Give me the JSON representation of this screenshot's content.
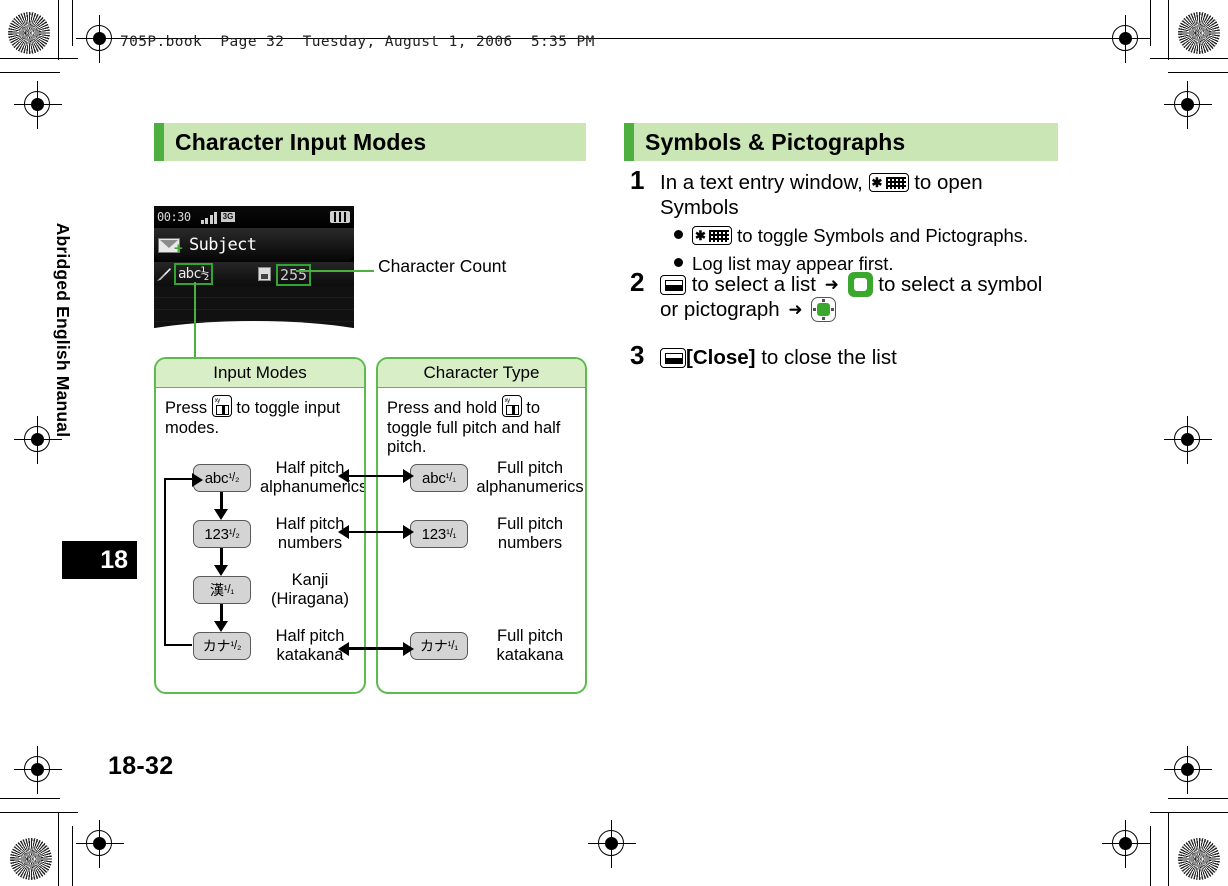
{
  "header": {
    "running_head": "705P.book  Page 32  Tuesday, August 1, 2006  5:35 PM"
  },
  "side_tab": {
    "label": "Abridged English Manual",
    "chapter_number": "18"
  },
  "folio": "18-32",
  "left_column": {
    "section_title": "Character Input Modes",
    "accent_color": "#4caf3f",
    "band_color": "#c9e6b4",
    "phone_screen": {
      "status_time": "00:30",
      "network_label": "3G",
      "title_text": "Subject",
      "input_mode_chip": "abc½",
      "char_count_chip": "255",
      "icons": [
        "signal-bars-icon",
        "battery-icon",
        "new-mail-icon",
        "pencil-icon",
        "memo-icon"
      ]
    },
    "callout": {
      "label": "Character Count"
    },
    "panels": [
      {
        "id": "input-modes",
        "title": "Input Modes",
        "description_pre": "Press",
        "description_post": "to toggle input modes.",
        "rows": [
          {
            "chip_main": "abc",
            "chip_frac": "¹/₂",
            "label_line1": "Half pitch",
            "label_line2": "alphanumerics"
          },
          {
            "chip_main": "123",
            "chip_frac": "¹/₂",
            "label_line1": "Half pitch",
            "label_line2": "numbers"
          },
          {
            "chip_main": "漢",
            "chip_frac": "¹/₁",
            "label_line1": "Kanji",
            "label_line2": "(Hiragana)"
          },
          {
            "chip_main": "カナ",
            "chip_frac": "¹/₂",
            "label_line1": "Half pitch",
            "label_line2": "katakana"
          }
        ]
      },
      {
        "id": "character-type",
        "title": "Character Type",
        "description_pre": "Press and hold",
        "description_post": "to toggle full pitch and half pitch.",
        "rows": [
          {
            "chip_main": "abc",
            "chip_frac": "¹/₁",
            "label_line1": "Full pitch",
            "label_line2": "alphanumerics"
          },
          {
            "chip_main": "123",
            "chip_frac": "¹/₁",
            "label_line1": "Full pitch",
            "label_line2": "numbers"
          },
          {
            "chip_main": "カナ",
            "chip_frac": "¹/₁",
            "label_line1": "Full pitch",
            "label_line2": "katakana"
          }
        ]
      }
    ]
  },
  "right_column": {
    "section_title": "Symbols & Pictographs",
    "steps": [
      {
        "number": "1",
        "text_before": "In a text entry window,",
        "text_after": "to open Symbols",
        "bullets": [
          {
            "text_before": "",
            "text_after": "to toggle Symbols and Pictographs.",
            "has_key": true
          },
          {
            "text_before": "",
            "text_after": "Log list may appear first.",
            "has_key": false
          }
        ]
      },
      {
        "number": "2",
        "seg1": "to select a list",
        "seg2": "to select a symbol or pictograph",
        "arrow": "➜"
      },
      {
        "number": "3",
        "bracket_label": "[Close]",
        "text_after": "to close the list"
      }
    ]
  }
}
